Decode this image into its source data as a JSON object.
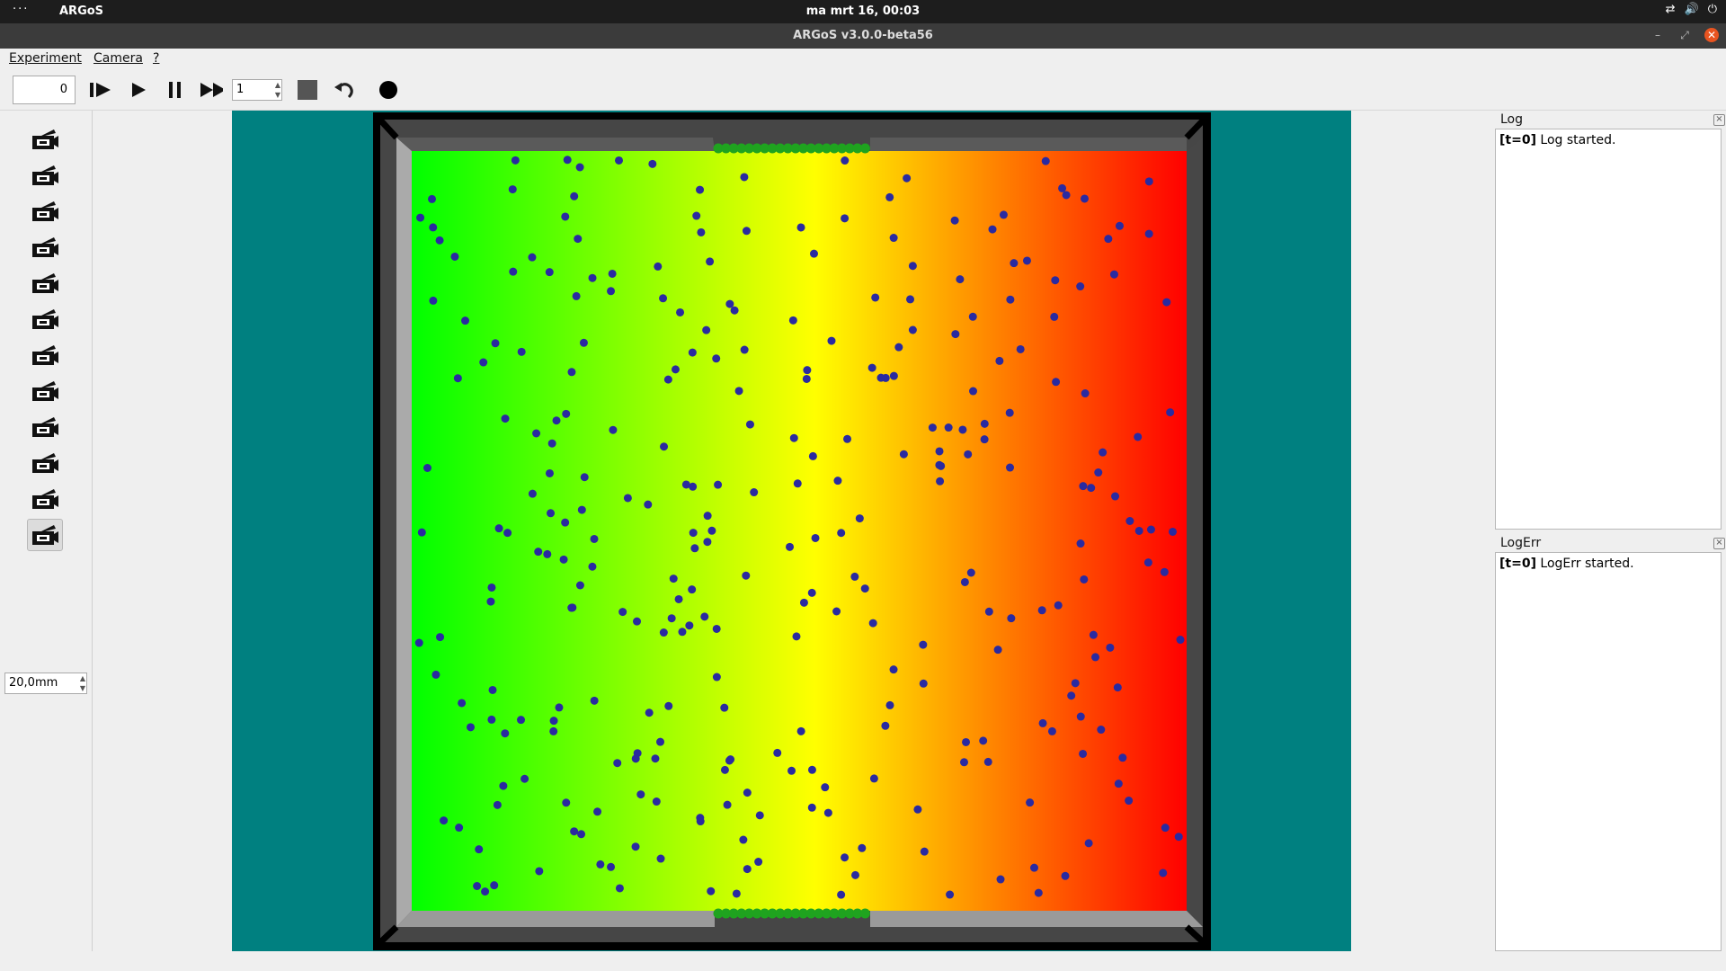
{
  "system_bar": {
    "activities": "···",
    "app_name": "ARGoS",
    "clock": "ma mrt 16, 00:03",
    "tray_icons": [
      "network-icon",
      "volume-icon",
      "power-icon"
    ]
  },
  "window": {
    "title": "ARGoS v3.0.0-beta56",
    "close_color": "#e95420"
  },
  "menu": {
    "experiment": "Experiment",
    "camera": "Camera",
    "help": "?"
  },
  "toolbar": {
    "frame_value": "0",
    "speed_value": "1",
    "buttons": [
      "step-icon",
      "play-icon",
      "pause-icon",
      "fast-forward-icon",
      "stop-icon",
      "reset-icon",
      "record-icon"
    ]
  },
  "camera_panel": {
    "camera_count": 12,
    "active_camera": 12,
    "focal_length": "20,0mm"
  },
  "arena": {
    "background": "#008080",
    "gradient": [
      "#00ff00",
      "#ffff00",
      "#ff0000"
    ],
    "robot_color": "#2a2aa0",
    "nest_color": "#1fa31f",
    "robot_count": 300,
    "nest_robots_per_row": 20
  },
  "log": {
    "title": "Log",
    "prefix": "[t=0]",
    "text": " Log started."
  },
  "logerr": {
    "title": "LogErr",
    "prefix": "[t=0]",
    "text": " LogErr started."
  }
}
